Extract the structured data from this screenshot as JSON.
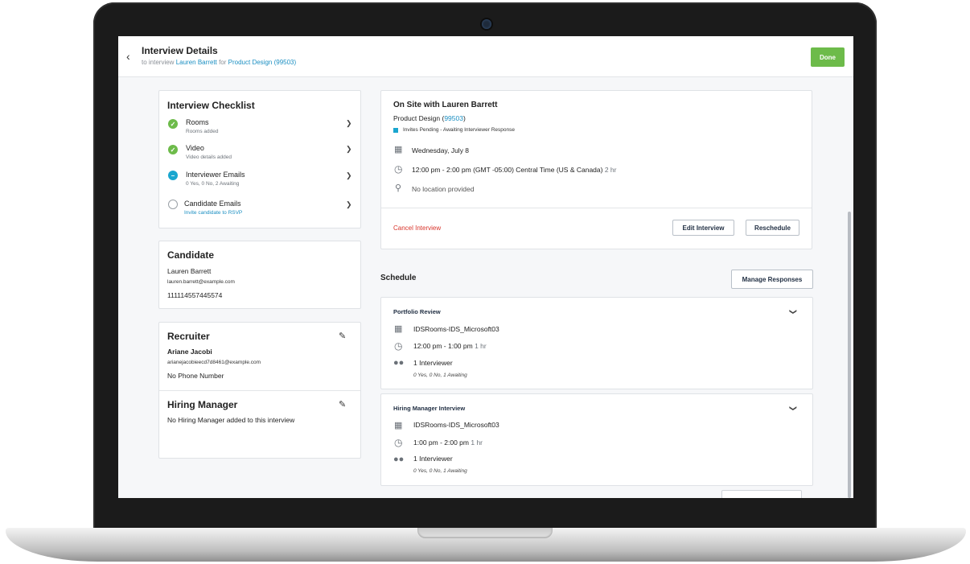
{
  "header": {
    "title": "Interview Details",
    "sub_prefix": "to interview",
    "candidate_link": "Lauren Barrett",
    "sub_for": "for",
    "job_link": "Product Design (99503)",
    "done_label": "Done"
  },
  "checklist": {
    "title": "Interview Checklist",
    "items": [
      {
        "label": "Rooms",
        "status": "Rooms added"
      },
      {
        "label": "Video",
        "status": "Video details added"
      },
      {
        "label": "Interviewer Emails",
        "status": "0 Yes, 0 No, 2 Awaiting"
      },
      {
        "label": "Candidate Emails",
        "status": "Invite candidate to RSVP"
      }
    ]
  },
  "candidate": {
    "title": "Candidate",
    "name": "Lauren Barrett",
    "email": "lauren.barrett@example.com",
    "phone": "111114557445574"
  },
  "recruiter": {
    "title": "Recruiter",
    "name": "Ariane Jacobi",
    "email": "arianejacobieecd7d8461@example.com",
    "phone": "No Phone Number"
  },
  "hiring_manager": {
    "title": "Hiring Manager",
    "text": "No Hiring Manager added to this interview"
  },
  "interview": {
    "title": "On Site with Lauren Barrett",
    "job_prefix": "Product Design (",
    "job_id": "99503",
    "job_suffix": ")",
    "status": "Invites Pending - Awaiting Interviewer Response",
    "date": "Wednesday, July 8",
    "time": "12:00 pm - 2:00 pm (GMT -05:00) Central Time (US & Canada)",
    "duration": "2 hr",
    "location": "No location provided",
    "cancel_label": "Cancel Interview",
    "edit_label": "Edit Interview",
    "reschedule_label": "Reschedule"
  },
  "schedule": {
    "title": "Schedule",
    "manage_label": "Manage Responses",
    "sessions": [
      {
        "name": "Portfolio Review",
        "room": "IDSRooms-IDS_Microsoft03",
        "time": "12:00 pm - 1:00 pm",
        "duration": "1 hr",
        "interviewers": "1 Interviewer",
        "responses": "0 Yes, 0 No, 1 Awaiting"
      },
      {
        "name": "Hiring Manager Interview",
        "room": "IDSRooms-IDS_Microsoft03",
        "time": "1:00 pm - 2:00 pm",
        "duration": "1 hr",
        "interviewers": "1 Interviewer",
        "responses": "0 Yes, 0 No, 1 Awaiting"
      }
    ]
  },
  "colors": {
    "accent": "#1b8fc2",
    "done_green": "#6dbb4a",
    "cancel_red": "#d8342b",
    "status_cyan": "#1aa6cf"
  }
}
